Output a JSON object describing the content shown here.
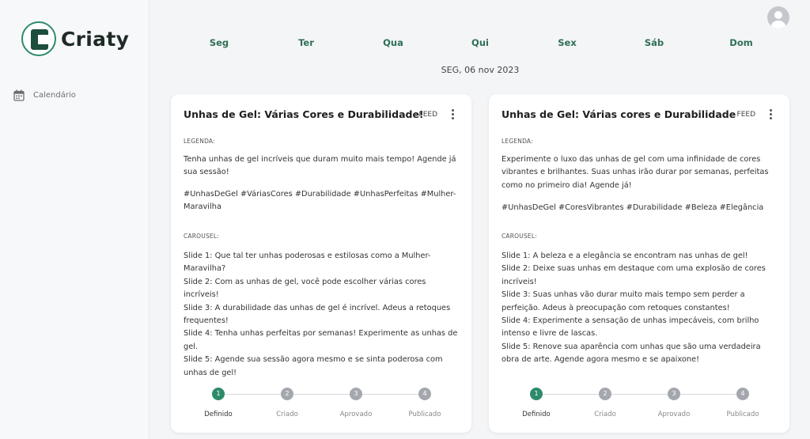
{
  "app": {
    "name": "Criaty"
  },
  "sidebar": {
    "items": [
      {
        "label": "Calendário",
        "icon": "calendar-icon"
      }
    ]
  },
  "header": {
    "days": [
      "Seg",
      "Ter",
      "Qua",
      "Qui",
      "Sex",
      "Sáb",
      "Dom"
    ],
    "date": "SEG, 06 nov 2023",
    "avatar_icon": "user-avatar-icon"
  },
  "colors": {
    "accent": "#2e8b6a",
    "day_text": "#2f6f56"
  },
  "cards": [
    {
      "title": "Unhas de Gel: Várias Cores e Durabilidade!",
      "type": "FEED",
      "caption_label": "LEGENDA:",
      "caption": "Tenha unhas de gel incríveis que duram muito mais tempo! Agende já sua sessão!",
      "hashtags": "#UnhasDeGel #VáriasCores #Durabilidade #UnhasPerfeitas #Mulher-Maravilha",
      "carousel_label": "CAROUSEL:",
      "slides": [
        "Slide 1: Que tal ter unhas poderosas e estilosas como a Mulher-Maravilha?",
        "Slide 2: Com as unhas de gel, você pode escolher várias cores incríveis!",
        "Slide 3: A durabilidade das unhas de gel é incrível. Adeus a retoques frequentes!",
        "Slide 4: Tenha unhas perfeitas por semanas! Experimente as unhas de gel.",
        "Slide 5: Agende sua sessão agora mesmo e se sinta poderosa com unhas de gel!"
      ],
      "steps": [
        {
          "num": "1",
          "label": "Definido",
          "active": true
        },
        {
          "num": "2",
          "label": "Criado",
          "active": false
        },
        {
          "num": "3",
          "label": "Aprovado",
          "active": false
        },
        {
          "num": "4",
          "label": "Publicado",
          "active": false
        }
      ]
    },
    {
      "title": "Unhas de Gel: Várias cores e Durabilidade",
      "type": "FEED",
      "caption_label": "LEGENDA:",
      "caption": "Experimente o luxo das unhas de gel com uma infinidade de cores vibrantes e brilhantes. Suas unhas irão durar por semanas, perfeitas como no primeiro dia! Agende já!",
      "hashtags": "#UnhasDeGel #CoresVibrantes #Durabilidade #Beleza #Elegância",
      "carousel_label": "CAROUSEL:",
      "slides": [
        "Slide 1: A beleza e a elegância se encontram nas unhas de gel!",
        "Slide 2: Deixe suas unhas em destaque com uma explosão de cores incríveis!",
        "Slide 3: Suas unhas vão durar muito mais tempo sem perder a perfeição. Adeus à preocupação com retoques constantes!",
        "Slide 4: Experimente a sensação de unhas impecáveis, com brilho intenso e livre de lascas.",
        "Slide 5: Renove sua aparência com unhas que são uma verdadeira obra de arte. Agende agora mesmo e se apaixone!"
      ],
      "steps": [
        {
          "num": "1",
          "label": "Definido",
          "active": true
        },
        {
          "num": "2",
          "label": "Criado",
          "active": false
        },
        {
          "num": "3",
          "label": "Aprovado",
          "active": false
        },
        {
          "num": "4",
          "label": "Publicado",
          "active": false
        }
      ]
    }
  ]
}
